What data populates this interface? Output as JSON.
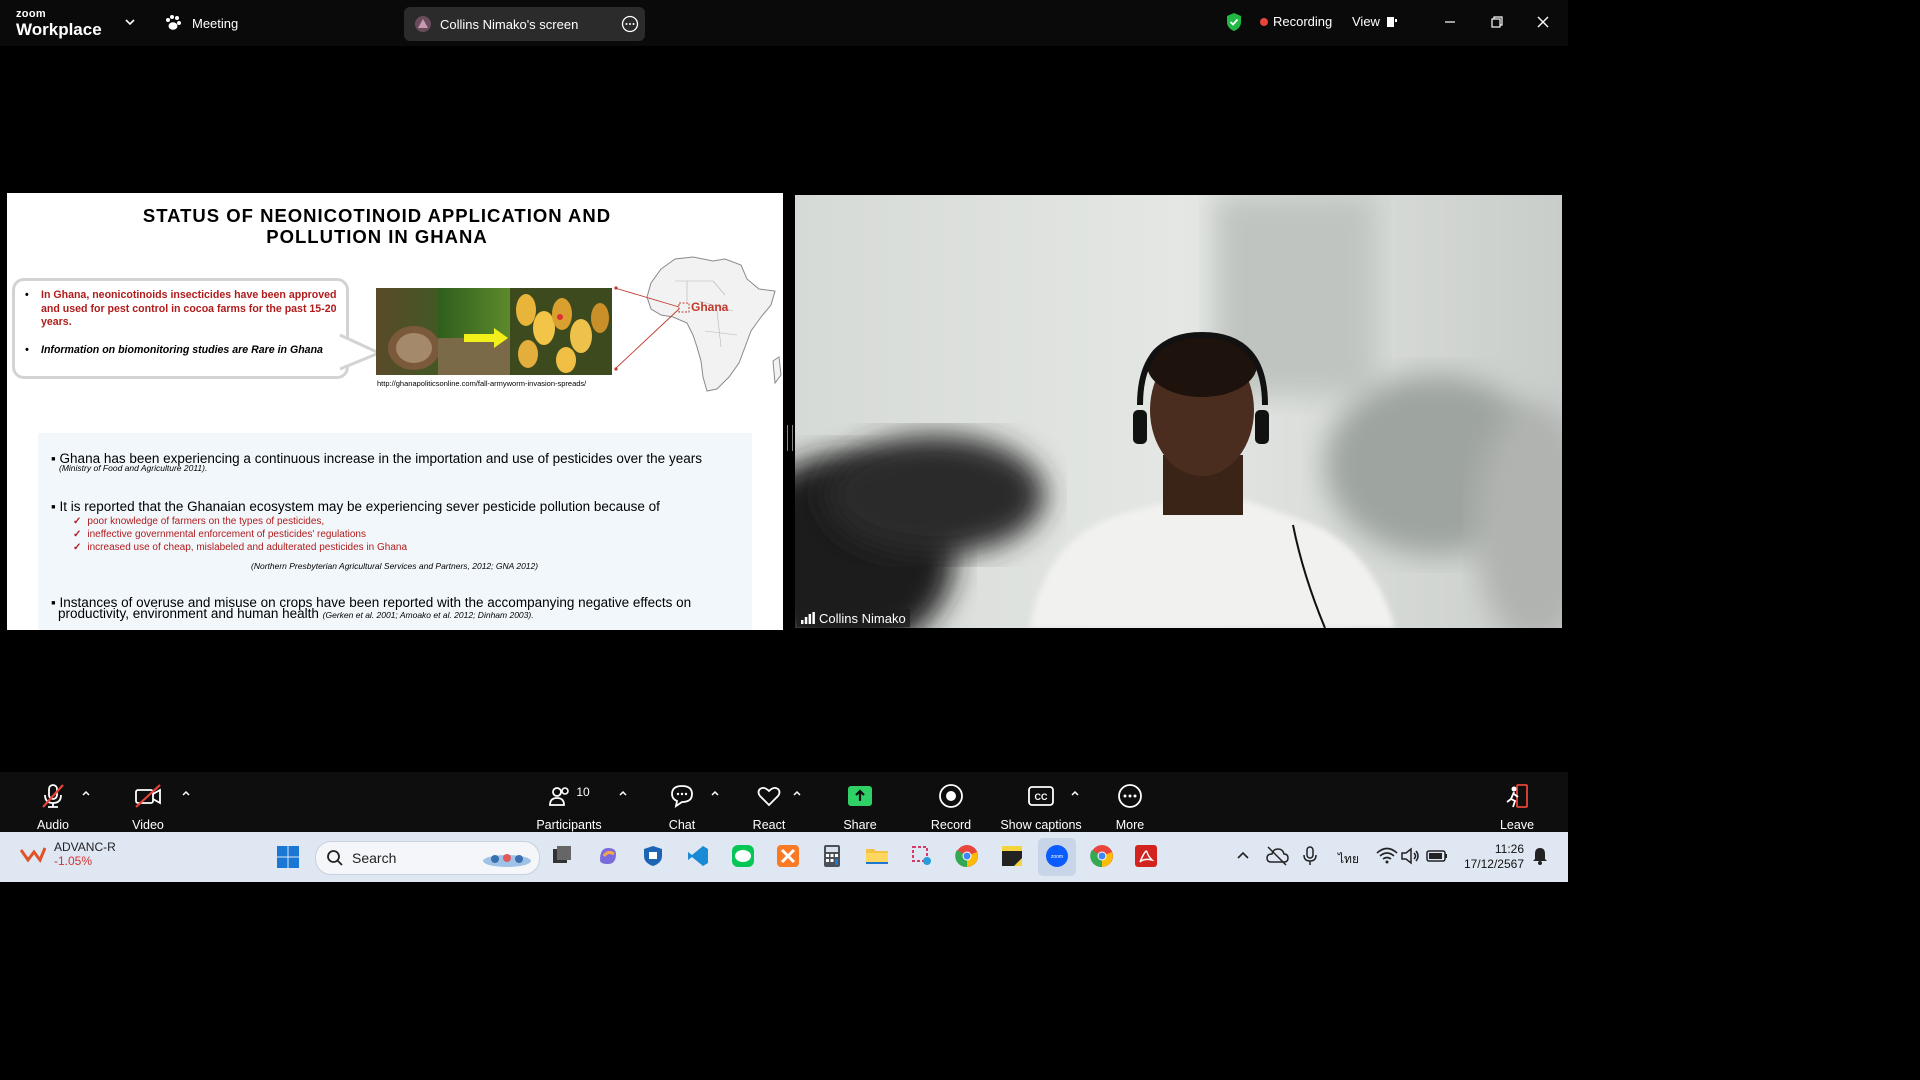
{
  "app": {
    "logo_top": "zoom",
    "logo_bottom": "Workplace"
  },
  "topbar": {
    "meeting_label": "Meeting",
    "screen_label": "Collins Nimako's screen",
    "recording_label": "Recording",
    "view_label": "View"
  },
  "slide": {
    "title_line1": "STATUS OF NEONICOTINOID APPLICATION AND",
    "title_line2": "POLLUTION IN GHANA",
    "callout_1": "In Ghana, neonicotinoids insecticides have been approved and used for pest control in cocoa farms for the past 15-20 years.",
    "callout_2": "Information on biomonitoring studies are Rare in Ghana",
    "map_label": "Ghana",
    "source_url": "http://ghanapoliticsonline.com/fall-armyworm-invasion-spreads/",
    "bullet_1": "Ghana has been experiencing a continuous increase in the importation and use of pesticides over the years",
    "bullet_1_cite": "(Ministry of Food and Agriculture 2011).",
    "bullet_2": "It is reported that the Ghanaian ecosystem may be experiencing sever pesticide pollution because of",
    "checks": [
      "poor knowledge of farmers on the types of pesticides,",
      "ineffective governmental enforcement of pesticides' regulations",
      "increased use of cheap, mislabeled and adulterated pesticides in Ghana"
    ],
    "bullet_2_cite": "(Northern Presbyterian Agricultural Services and Partners, 2012; GNA 2012)",
    "bullet_3_line1": "Instances of overuse and misuse on crops have been reported with the accompanying negative effects on",
    "bullet_3_line2": "productivity, environment and human health",
    "bullet_3_cite": "(Gerken et al. 2001; Amoako et al. 2012; Dinham 2003)."
  },
  "video": {
    "participant_name": "Collins Nimako"
  },
  "controls": {
    "audio": "Audio",
    "video": "Video",
    "participants": "Participants",
    "participants_count": "10",
    "chat": "Chat",
    "react": "React",
    "share": "Share",
    "record": "Record",
    "captions": "Show captions",
    "more": "More",
    "leave": "Leave"
  },
  "taskbar": {
    "stock_name": "ADVANC-R",
    "stock_change": "-1.05%",
    "search_placeholder": "Search",
    "lang": "ไทย",
    "time": "11:26",
    "date": "17/12/2567"
  },
  "colors": {
    "accent_red": "#b01c1c",
    "share_green": "#2fd065",
    "recording_dot": "#e8443a"
  }
}
